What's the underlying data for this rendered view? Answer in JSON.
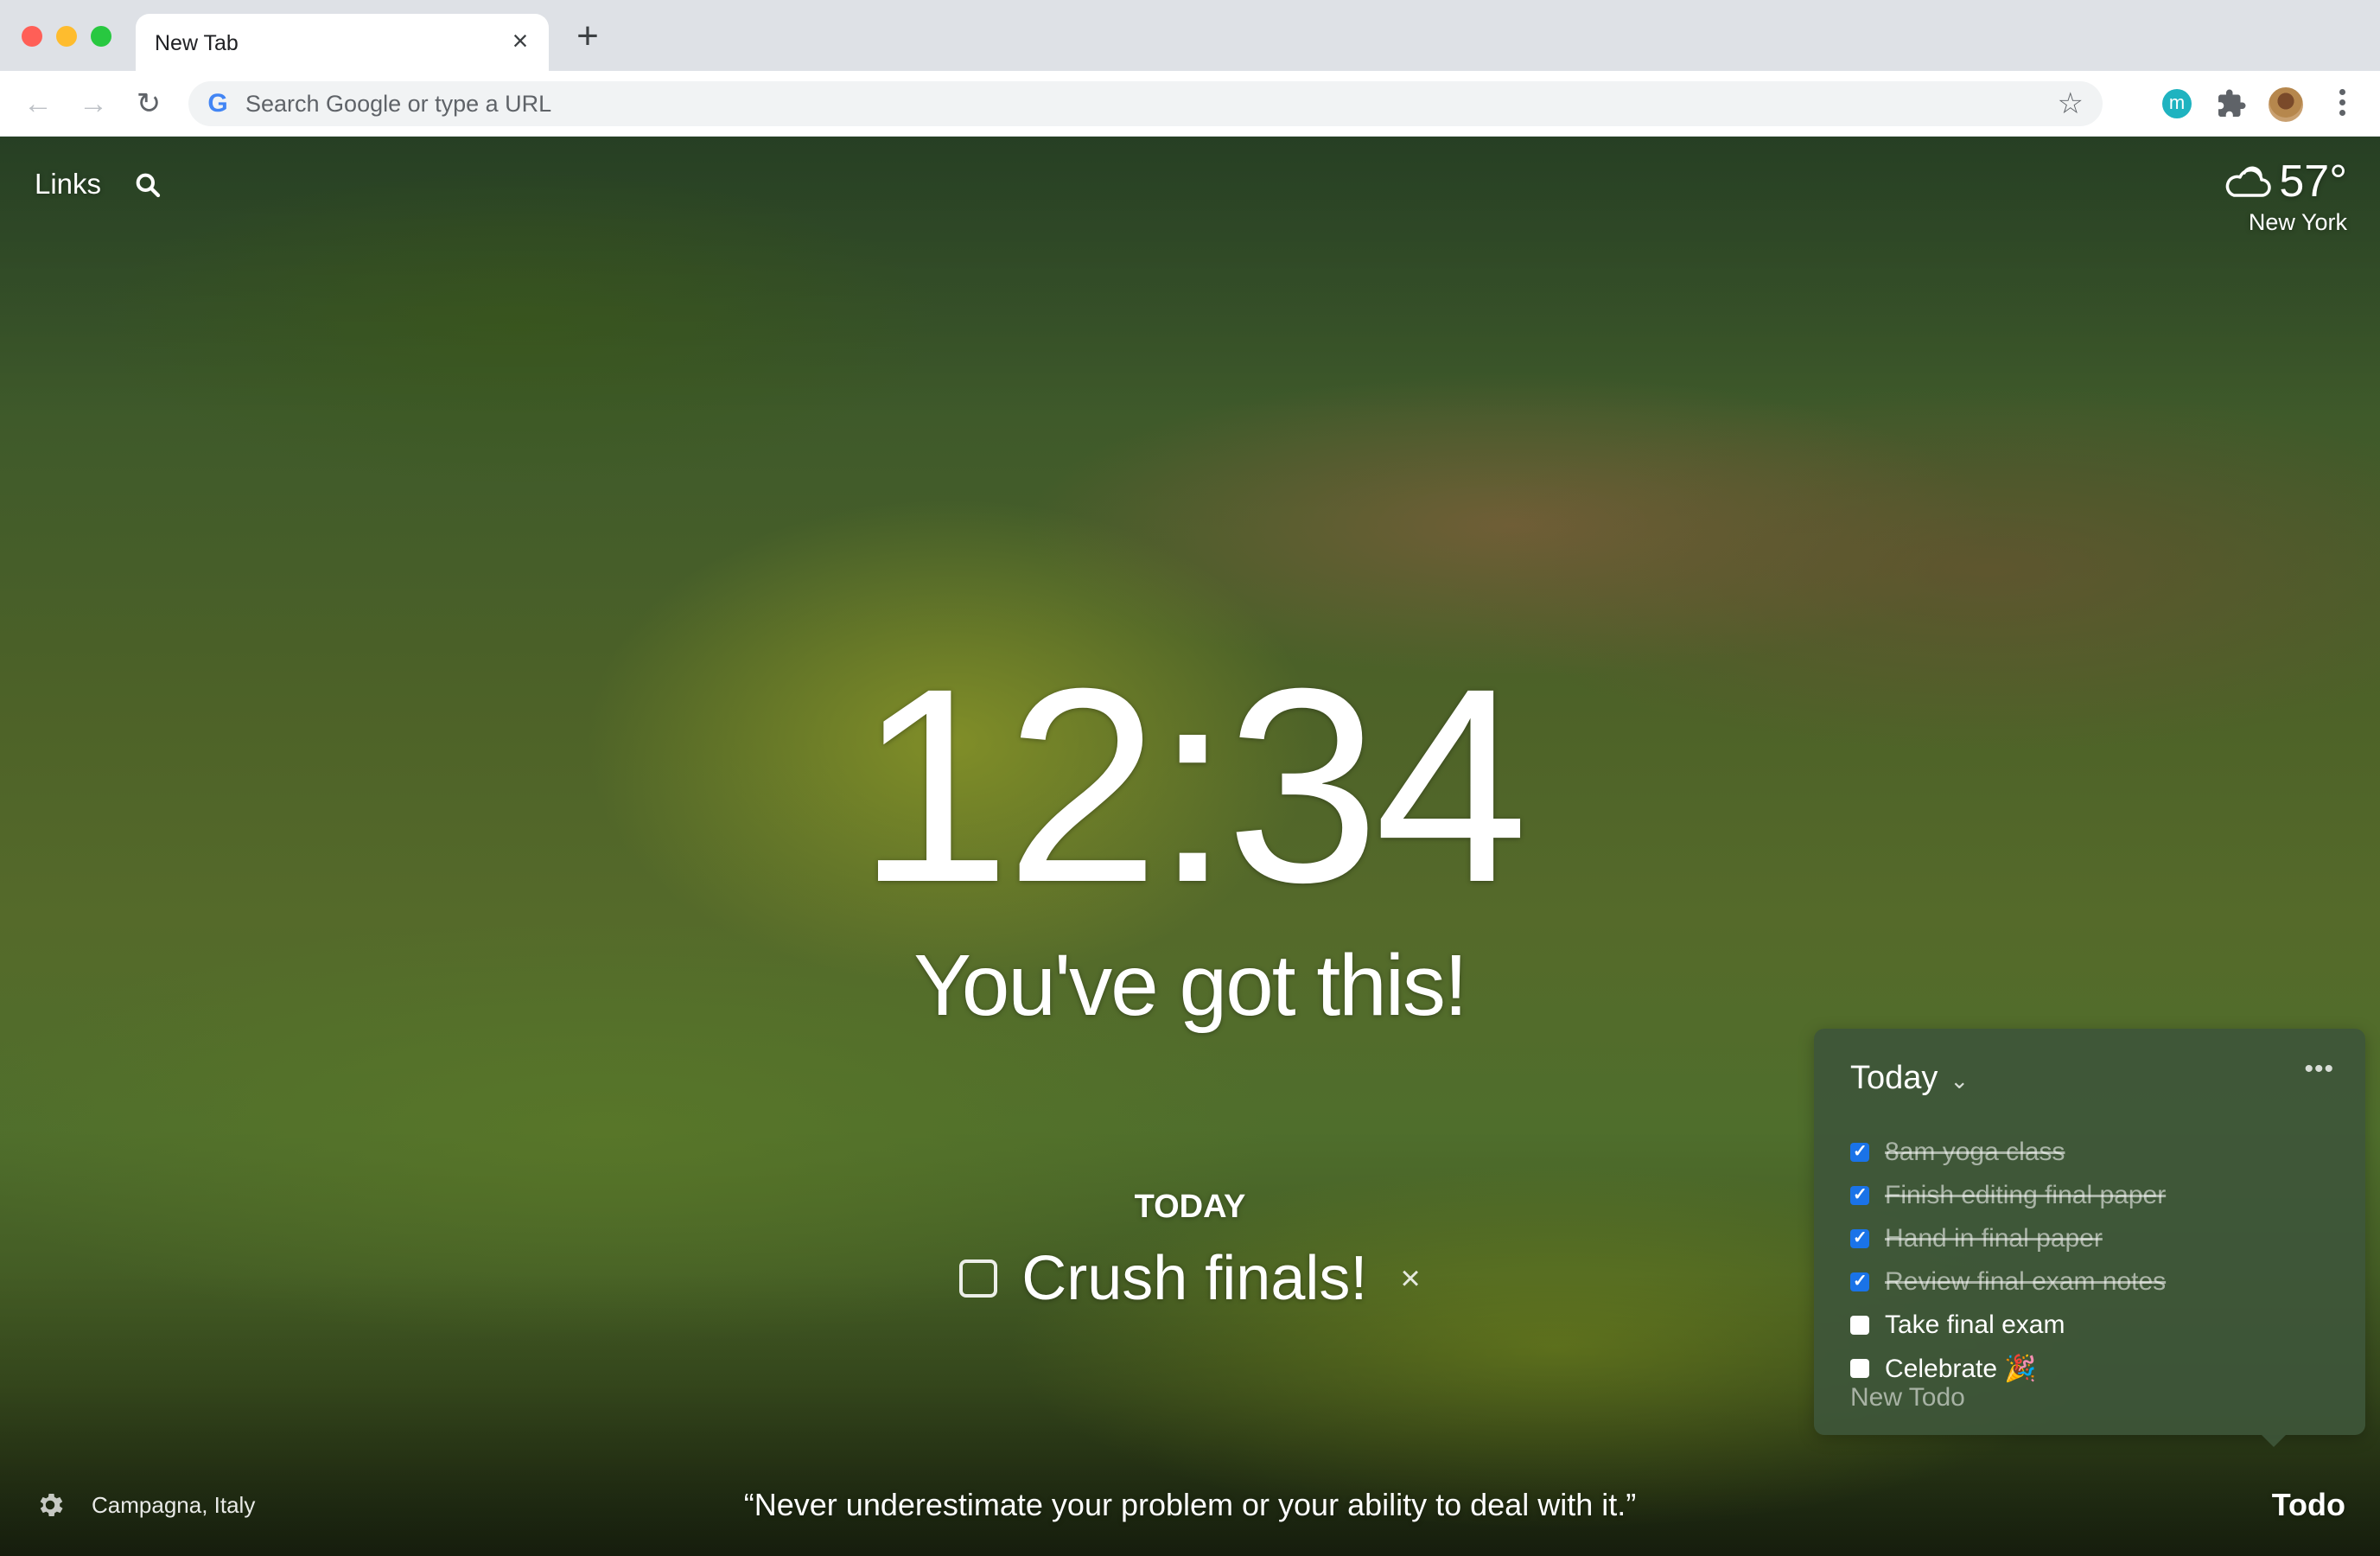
{
  "browser": {
    "tab_title": "New Tab",
    "omnibox_placeholder": "Search Google or type a URL",
    "extension_badge": "m",
    "colors": {
      "extension_badge": "#1fb3c0",
      "checkbox_checked": "#1a73e8"
    }
  },
  "dashboard": {
    "links_label": "Links",
    "weather": {
      "temperature": "57°",
      "city": "New York",
      "condition_icon": "cloudy-icon"
    },
    "clock": "12:34",
    "mantra": "You've got this!",
    "focus": {
      "label": "TODAY",
      "text": "Crush finals!",
      "completed": false
    },
    "todo_panel": {
      "list_name": "Today",
      "items": [
        {
          "text": "8am yoga class",
          "done": true
        },
        {
          "text": "Finish editing final paper",
          "done": true
        },
        {
          "text": "Hand in final paper",
          "done": true
        },
        {
          "text": "Review final exam notes",
          "done": true
        },
        {
          "text": "Take final exam",
          "done": false
        },
        {
          "text": "Celebrate 🎉",
          "done": false
        }
      ],
      "new_todo_placeholder": "New Todo"
    },
    "photo_location": "Campagna, Italy",
    "quote": "“Never underestimate your problem or your ability to deal with it.”",
    "todo_toggle_label": "Todo"
  }
}
